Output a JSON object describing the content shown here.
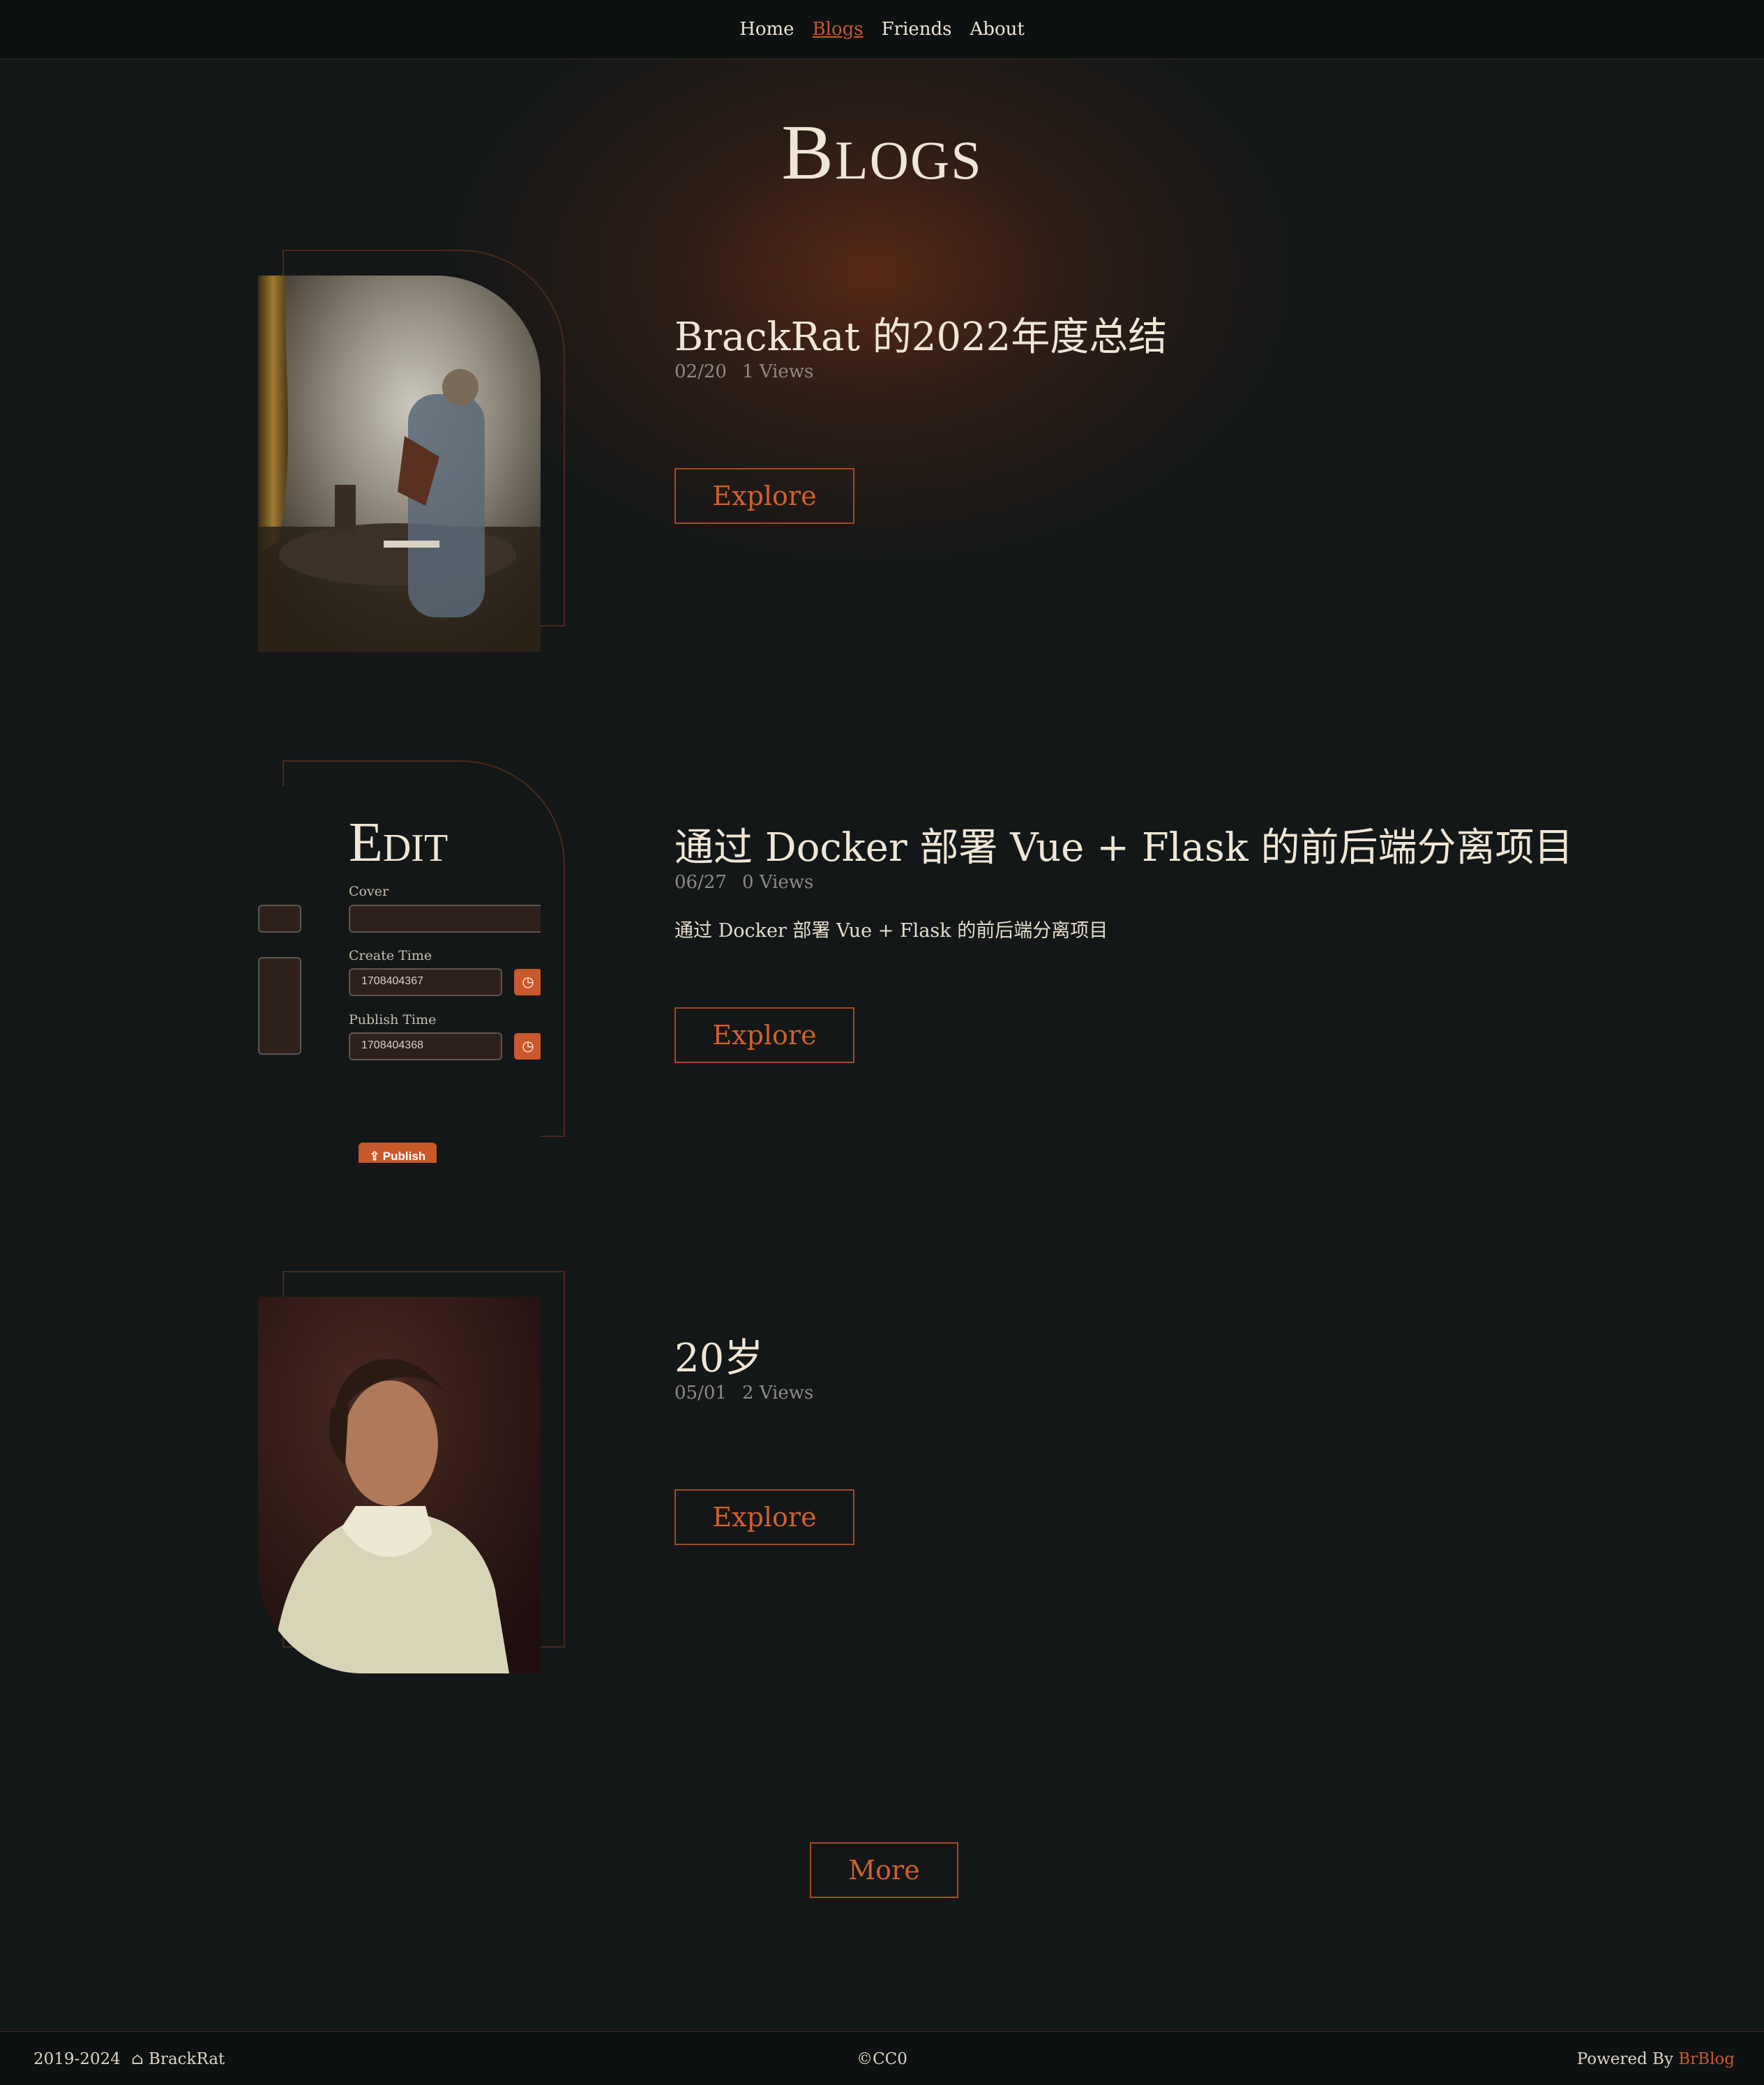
{
  "nav": {
    "items": [
      {
        "label": "Home",
        "active": false
      },
      {
        "label": "Blogs",
        "active": true
      },
      {
        "label": "Friends",
        "active": false
      },
      {
        "label": "About",
        "active": false
      }
    ]
  },
  "page": {
    "title": "Blogs"
  },
  "posts": [
    {
      "title": "BrackRat 的2022年度总结",
      "date": "02/20",
      "views": "1 Views",
      "description": "",
      "button": "Explore",
      "cover": "painting-woman-with-violin-icon"
    },
    {
      "title": "通过 Docker 部署 Vue + Flask 的前后端分离项目",
      "date": "06/27",
      "views": "0 Views",
      "description": "通过 Docker 部署 Vue + Flask 的前后端分离项目",
      "button": "Explore",
      "cover": "editor-screenshot",
      "cover_ui": {
        "title": "Edit",
        "cover_label": "Cover",
        "create_label": "Create Time",
        "create_value": "1708404367",
        "publish_label": "Publish Time",
        "publish_value": "1708404368",
        "publish_button": "Publish"
      }
    },
    {
      "title": "20岁",
      "date": "05/01",
      "views": "2 Views",
      "description": "",
      "button": "Explore",
      "cover": "portrait-boy-in-white-icon"
    }
  ],
  "more_button": "More",
  "footer": {
    "years": "2019-2024",
    "author": "BrackRat",
    "license": "©CC0",
    "powered_prefix": "Powered By",
    "powered_brand": "BrBlog"
  },
  "colors": {
    "accent": "#c9582a",
    "background": "#131718",
    "text": "#efe6d6"
  }
}
